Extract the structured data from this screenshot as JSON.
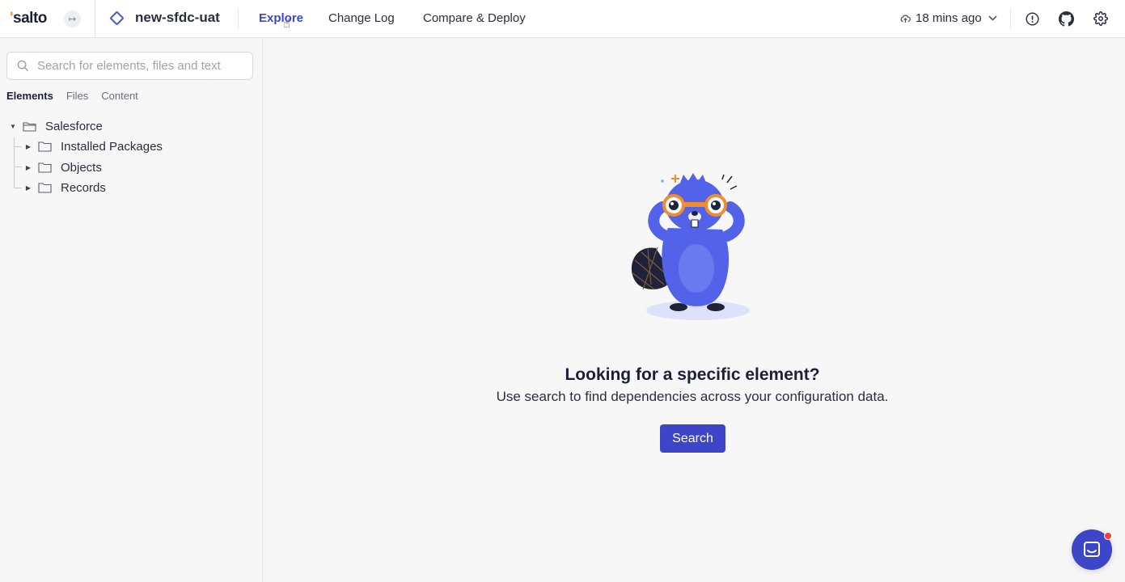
{
  "header": {
    "logo_text": "salto",
    "env_name": "new-sfdc-uat",
    "nav": [
      {
        "label": "Explore",
        "active": true
      },
      {
        "label": "Change Log",
        "active": false
      },
      {
        "label": "Compare & Deploy",
        "active": false
      }
    ],
    "sync_label": "18 mins ago",
    "icons": [
      "collapse-icon",
      "environment-icon",
      "cloud-sync-icon",
      "chevron-down-icon",
      "info-icon",
      "github-icon",
      "gear-icon"
    ]
  },
  "sidebar": {
    "search_placeholder": "Search for elements, files and text",
    "tabs": [
      {
        "label": "Elements",
        "active": true
      },
      {
        "label": "Files",
        "active": false
      },
      {
        "label": "Content",
        "active": false
      }
    ],
    "tree": {
      "root": {
        "label": "Salesforce",
        "expanded": true
      },
      "children": [
        {
          "label": "Installed Packages",
          "expanded": false
        },
        {
          "label": "Objects",
          "expanded": false
        },
        {
          "label": "Records",
          "expanded": false
        }
      ]
    }
  },
  "main": {
    "empty_title": "Looking for a specific element?",
    "empty_subtitle": "Use search to find dependencies across your configuration data.",
    "search_button": "Search"
  },
  "colors": {
    "accent": "#3d46c9",
    "logo_dot": "#ff9a1f",
    "notification": "#f24141"
  }
}
